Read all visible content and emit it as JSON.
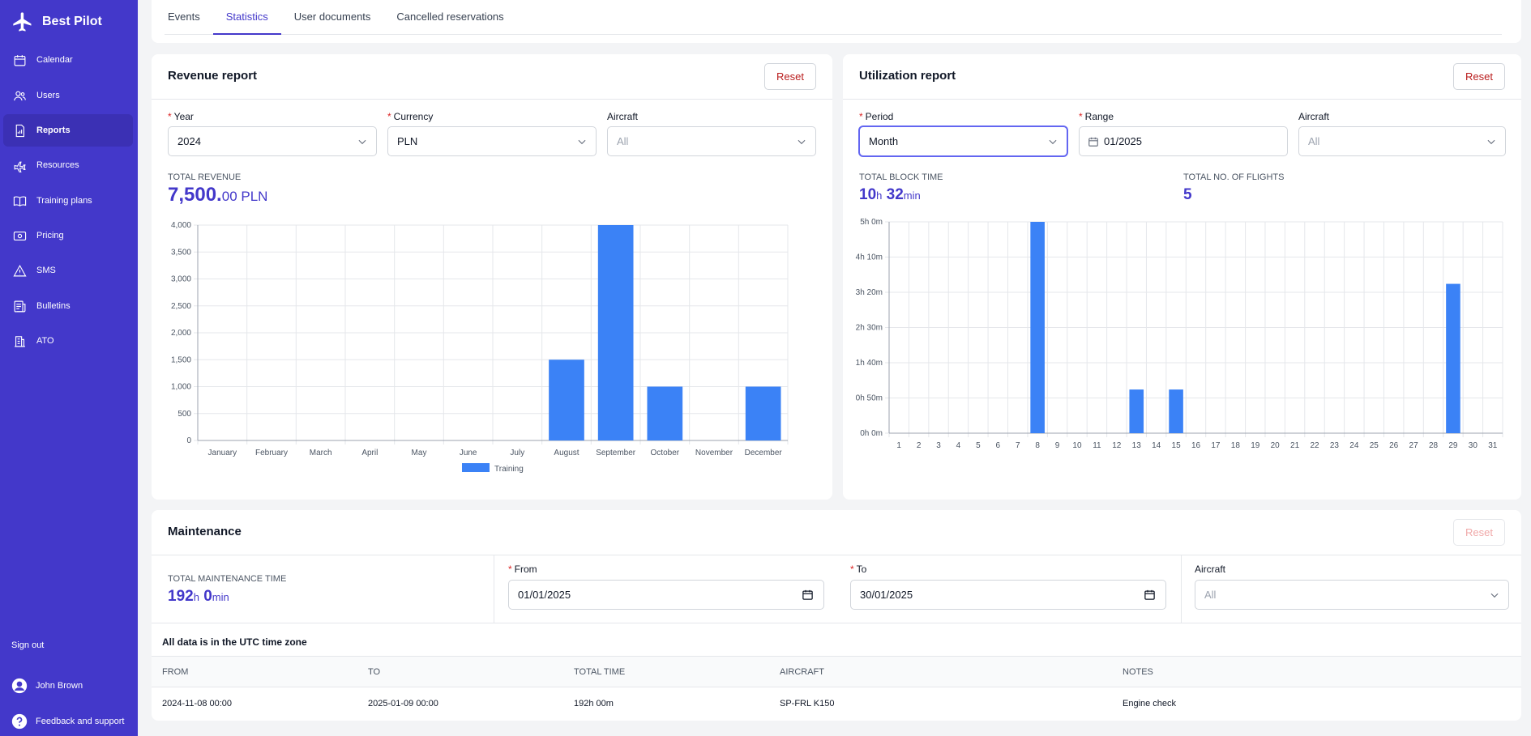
{
  "sidebar": {
    "brand": "Best Pilot",
    "items": [
      {
        "label": "Calendar",
        "icon": "calendar-icon"
      },
      {
        "label": "Users",
        "icon": "users-icon"
      },
      {
        "label": "Reports",
        "icon": "reports-icon",
        "active": true
      },
      {
        "label": "Resources",
        "icon": "plane-icon"
      },
      {
        "label": "Training plans",
        "icon": "book-icon"
      },
      {
        "label": "Pricing",
        "icon": "pricing-icon"
      },
      {
        "label": "SMS",
        "icon": "warning-icon"
      },
      {
        "label": "Bulletins",
        "icon": "bulletins-icon"
      },
      {
        "label": "ATO",
        "icon": "building-icon"
      }
    ],
    "sign_out": "Sign out",
    "user_name": "John Brown",
    "feedback": "Feedback and support"
  },
  "tabs": [
    "Events",
    "Statistics",
    "User documents",
    "Cancelled reservations"
  ],
  "active_tab": "Statistics",
  "revenue": {
    "title": "Revenue report",
    "reset": "Reset",
    "year_label": "Year",
    "year_value": "2024",
    "currency_label": "Currency",
    "currency_value": "PLN",
    "aircraft_label": "Aircraft",
    "aircraft_placeholder": "All",
    "total_label": "Total revenue",
    "total_int": "7,500.",
    "total_dec": "00 PLN"
  },
  "utilization": {
    "title": "Utilization report",
    "reset": "Reset",
    "period_label": "Period",
    "period_value": "Month",
    "range_label": "Range",
    "range_value": "01/2025",
    "aircraft_label": "Aircraft",
    "aircraft_placeholder": "All",
    "block_time_label": "Total block time",
    "block_hours": "10",
    "block_h_unit": "h",
    "block_mins": "32",
    "block_min_unit": "min",
    "flights_label": "Total no. of flights",
    "flights_value": "5"
  },
  "maintenance": {
    "title": "Maintenance",
    "reset": "Reset",
    "total_label": "Total maintenance time",
    "hours": "192",
    "h_unit": "h",
    "mins": "0",
    "min_unit": "min",
    "from_label": "From",
    "from_value": "01/01/2025",
    "to_label": "To",
    "to_value": "30/01/2025",
    "aircraft_label": "Aircraft",
    "aircraft_placeholder": "All",
    "utc_note": "All data is in the UTC time zone",
    "columns": [
      "From",
      "To",
      "Total time",
      "Aircraft",
      "Notes"
    ],
    "rows": [
      {
        "from": "2024-11-08 00:00",
        "to": "2025-01-09 00:00",
        "total_time": "192h 00m",
        "aircraft": "SP-FRL K150",
        "notes": "Engine check"
      }
    ]
  },
  "colors": {
    "accent": "#4338ca",
    "bar": "#3b82f6",
    "danger": "#b91c1c"
  },
  "chart_data": [
    {
      "type": "bar",
      "categories": [
        "January",
        "February",
        "March",
        "April",
        "May",
        "June",
        "July",
        "August",
        "September",
        "October",
        "November",
        "December"
      ],
      "series": [
        {
          "name": "Training",
          "values": [
            0,
            0,
            0,
            0,
            0,
            0,
            0,
            1500,
            4000,
            1000,
            0,
            1000
          ]
        }
      ],
      "ylim": [
        0,
        4000
      ],
      "yticks": [
        "0",
        "500",
        "1,000",
        "1,500",
        "2,000",
        "2,500",
        "3,000",
        "3,500",
        "4,000"
      ],
      "legend": "bottom",
      "grid": true
    },
    {
      "type": "bar",
      "categories": [
        "1",
        "2",
        "3",
        "4",
        "5",
        "6",
        "7",
        "8",
        "9",
        "10",
        "11",
        "12",
        "13",
        "14",
        "15",
        "16",
        "17",
        "18",
        "19",
        "20",
        "21",
        "22",
        "23",
        "24",
        "25",
        "26",
        "27",
        "28",
        "29",
        "30",
        "31"
      ],
      "series": [
        {
          "values_minutes": [
            0,
            0,
            0,
            0,
            0,
            0,
            0,
            300,
            0,
            0,
            0,
            0,
            62,
            0,
            62,
            0,
            0,
            0,
            0,
            0,
            0,
            0,
            0,
            0,
            0,
            0,
            0,
            0,
            212,
            0,
            0
          ]
        }
      ],
      "ylim_minutes": [
        0,
        300
      ],
      "yticks": [
        "0h 0m",
        "0h 50m",
        "1h 40m",
        "2h 30m",
        "3h 20m",
        "4h 10m",
        "5h 0m"
      ],
      "legend": "none",
      "grid": true
    }
  ]
}
